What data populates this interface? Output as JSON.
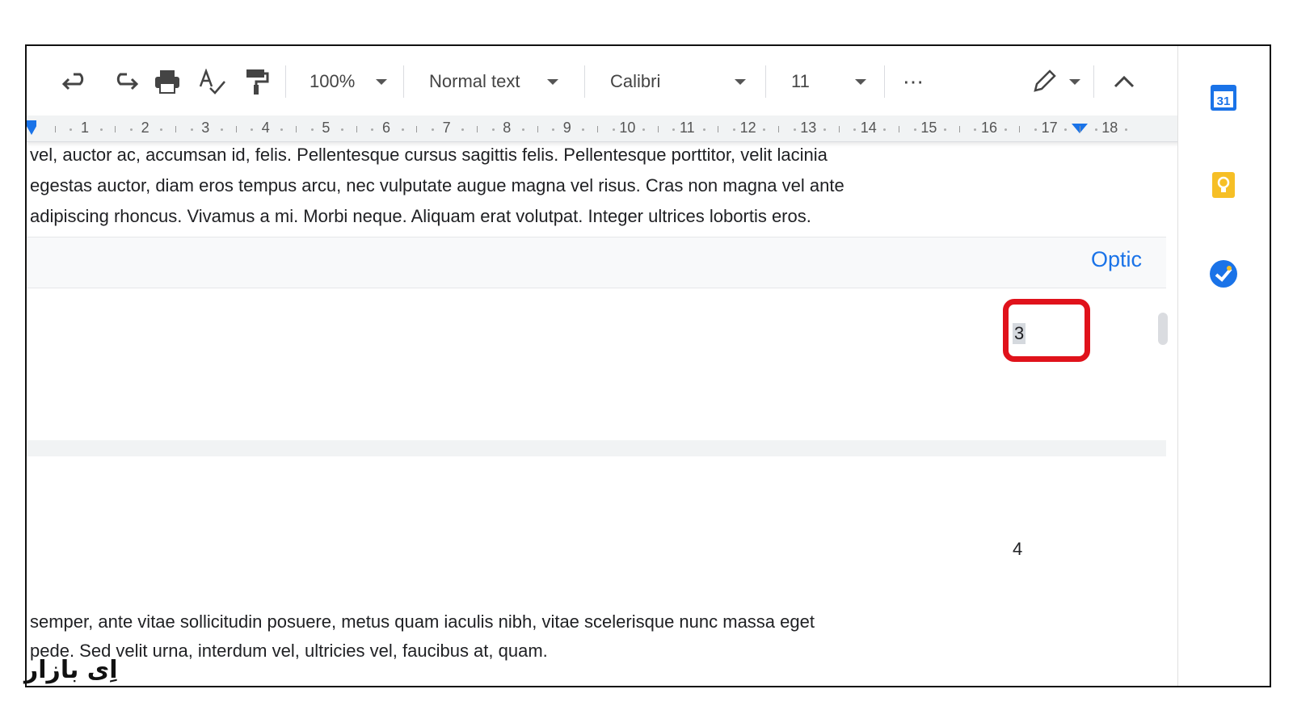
{
  "toolbar": {
    "zoom": "100%",
    "style": "Normal text",
    "font": "Calibri",
    "font_size": "11",
    "more": "⋯"
  },
  "ruler": {
    "numbers": [
      "1",
      "2",
      "3",
      "4",
      "5",
      "6",
      "7",
      "8",
      "9",
      "10",
      "11",
      "12",
      "13",
      "14",
      "15",
      "16",
      "17",
      "18"
    ]
  },
  "document": {
    "top_lines": [
      "vel, auctor ac, accumsan id, felis. Pellentesque cursus sagittis felis. Pellentesque porttitor, velit lacinia",
      "egestas auctor, diam eros tempus arcu, nec vulputate augue magna vel risus. Cras non magna vel ante",
      "adipiscing rhoncus. Vivamus a mi. Morbi neque. Aliquam erat volutpat. Integer ultrices lobortis eros."
    ],
    "footer_options_link": "Optic",
    "page_number_selected": "3",
    "page_number_next": "4",
    "bottom_lines": [
      "semper, ante vitae sollicitudin posuere, metus quam iaculis nibh, vitae scelerisque nunc massa eget",
      "pede. Sed velit urna, interdum vel, ultricies vel, faucibus at, quam."
    ]
  },
  "side_panel": {
    "calendar_day": "31"
  },
  "watermark": "اِی بازار",
  "colors": {
    "accent": "#1a73e8",
    "highlight": "#e0121b",
    "keep": "#f6bf26"
  }
}
